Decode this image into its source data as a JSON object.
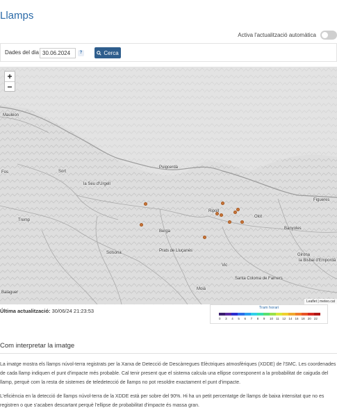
{
  "page": {
    "title": "Llamps"
  },
  "auto_update": {
    "label": "Activa l'actualització automàtica",
    "enabled": false
  },
  "search": {
    "date_label": "Dades del dia",
    "date_value": "30.06.2024",
    "help": "?",
    "button_label": "Cerca"
  },
  "map": {
    "zoom_in": "+",
    "zoom_out": "−",
    "towns": {
      "mauleon": "Mauléon",
      "fos": "Fos",
      "sort": "Sort",
      "seu": "la Seu d'Urgell",
      "puigcerda": "Puigcerdà",
      "figueres": "Figueres",
      "tremp": "Tremp",
      "ripoll": "Ripoll",
      "olot": "Olot",
      "berga": "Berga",
      "banyoles": "Banyoles",
      "solsona": "Solsona",
      "prats": "Prats de Lluçanès",
      "girona": "Girona",
      "bisbal": "la Bisbal d'Empordà",
      "vic": "Vic",
      "coloma": "Santa Coloma de Farners",
      "balaguer": "Balaguer",
      "moia": "Moià"
    },
    "attribution": "Leaflet | meteo.cat"
  },
  "last_update": {
    "label": "Última actualització:",
    "value": "30/06/24 21:23:53"
  },
  "legend": {
    "title": "Tram horari",
    "ticks": [
      "0",
      "3",
      "4",
      "5",
      "6",
      "7",
      "8",
      "9",
      "10",
      "11",
      "12",
      "14",
      "16",
      "18",
      "20",
      "22"
    ],
    "colors": [
      "#3b1f6e",
      "#5a2aa0",
      "#2c2ecf",
      "#2c6ee8",
      "#2aa0ef",
      "#32d0e8",
      "#3ae0b0",
      "#58e070",
      "#9ae04a",
      "#d8e83a",
      "#f0d030",
      "#f0a830",
      "#f07c2c",
      "#e85428",
      "#d62a22",
      "#b01818"
    ]
  },
  "info": {
    "title": "Com interpretar la imatge",
    "p1": "La imatge mostra els llamps núvol-terra registrats per la Xarxa de Detecció de Descàrregues Elèctriques atmosfèriques (XDDE) de l'SMC. Les coordenades de cada llamp indiquen el punt d'impacte més probable. Cal tenir present que el sistema calcula una ellipse corresponent a la probabilitat de caiguda del llamp, perquè com la resta de sistemes de teledetecció de llamps no pot resoldre exactament el punt d'impacte.",
    "p2": "L'eficiència en la detecció de llamps núvol-terra de la XDDE està per sobre del 90%. Hi ha un petit percentatge de llamps de baixa intensitat que no es registren o que s'acaben descartant perquè l'ellipse de probabilitat d'impacte és massa gran."
  }
}
